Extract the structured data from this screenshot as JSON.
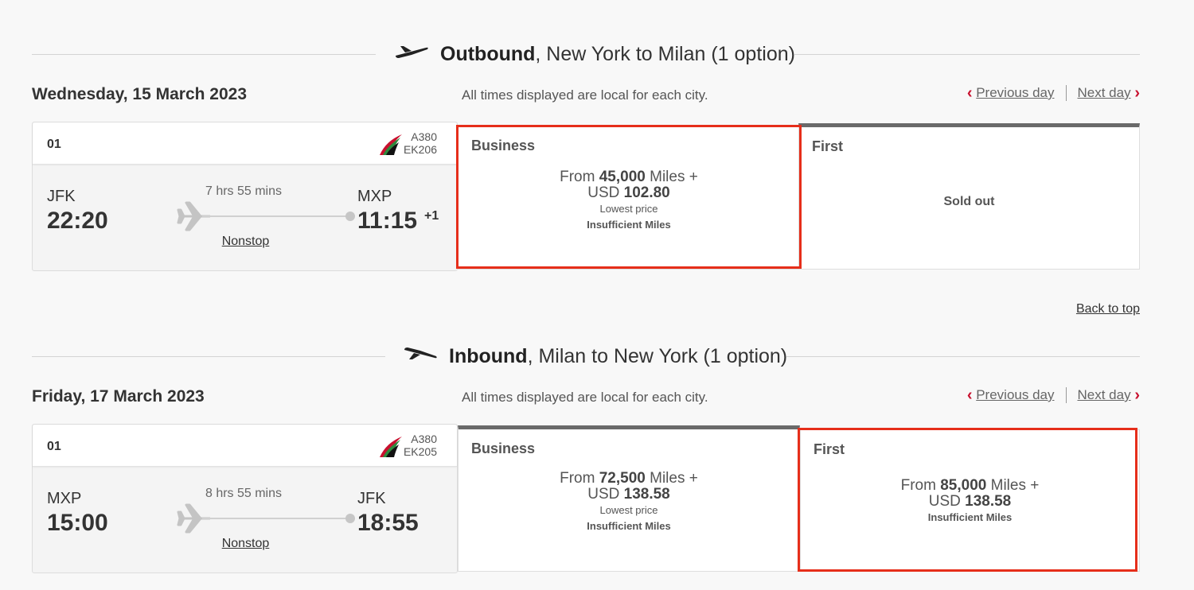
{
  "outbound": {
    "heading_bold": "Outbound",
    "heading_rest": ", New York to Milan (1 option)",
    "date": "Wednesday, 15 March 2023",
    "note": "All times displayed are local for each city.",
    "prev_day": "Previous day",
    "next_day": "Next day",
    "flight": {
      "number": "01",
      "aircraft": "A380",
      "flight_no": "EK206",
      "from_code": "JFK",
      "from_time": "22:20",
      "duration": "7 hrs 55 mins",
      "stops": "Nonstop",
      "to_code": "MXP",
      "to_time": "11:15",
      "day_offset": "+1"
    },
    "business": {
      "label": "Business",
      "from_prefix": "From ",
      "miles": "45,000",
      "miles_suffix": " Miles +",
      "currency": "USD ",
      "amount": "102.80",
      "sub": "Lowest price",
      "warning": "Insufficient Miles"
    },
    "first": {
      "label": "First",
      "status": "Sold out"
    }
  },
  "back_to_top": "Back to top",
  "inbound": {
    "heading_bold": "Inbound",
    "heading_rest": ", Milan to New York (1 option)",
    "date": "Friday, 17 March 2023",
    "note": "All times displayed are local for each city.",
    "prev_day": "Previous day",
    "next_day": "Next day",
    "flight": {
      "number": "01",
      "aircraft": "A380",
      "flight_no": "EK205",
      "from_code": "MXP",
      "from_time": "15:00",
      "duration": "8 hrs 55 mins",
      "stops": "Nonstop",
      "to_code": "JFK",
      "to_time": "18:55"
    },
    "business": {
      "label": "Business",
      "from_prefix": "From ",
      "miles": "72,500",
      "miles_suffix": " Miles +",
      "currency": "USD ",
      "amount": "138.58",
      "sub": "Lowest price",
      "warning": "Insufficient Miles"
    },
    "first": {
      "label": "First",
      "from_prefix": "From ",
      "miles": "85,000",
      "miles_suffix": " Miles +",
      "currency": "USD ",
      "amount": "138.58",
      "warning": "Insufficient Miles"
    }
  },
  "colors": {
    "accent": "#c8102e",
    "highlight": "#e62e1a",
    "tab": "#6a6a6a"
  }
}
